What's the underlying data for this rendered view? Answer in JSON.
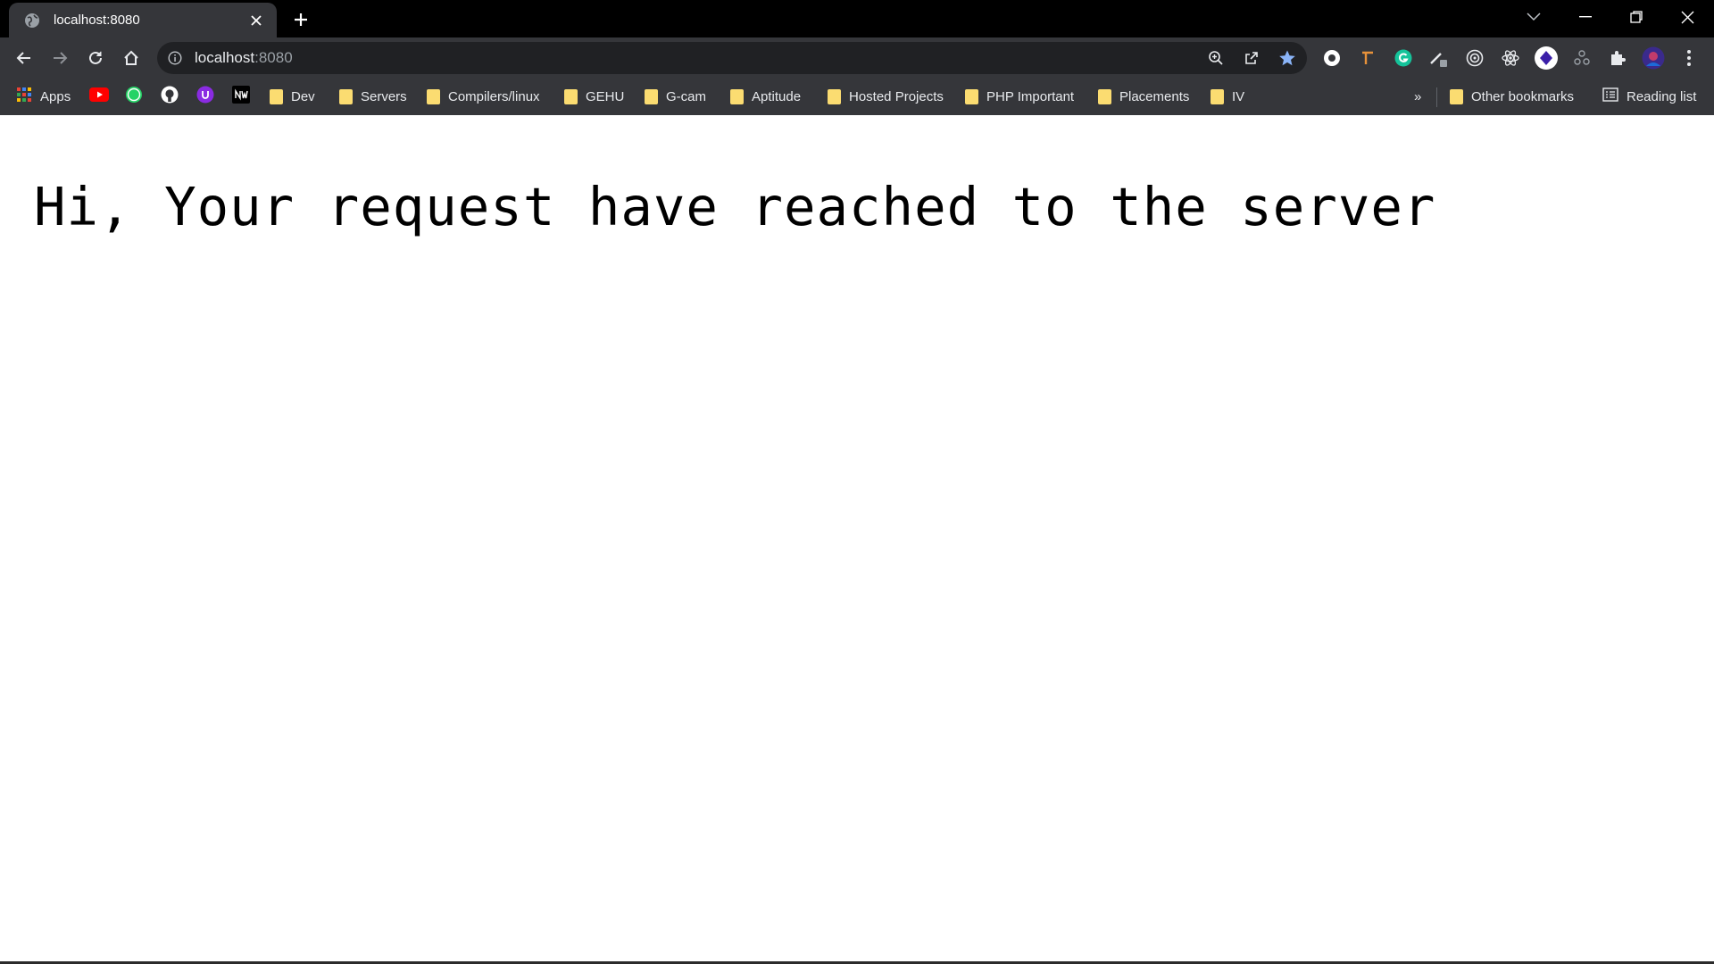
{
  "browser": {
    "tab": {
      "title": "localhost:8080"
    },
    "omnibox": {
      "host": "localhost",
      "port": ":8080"
    }
  },
  "bookmarks": {
    "apps_label": "Apps",
    "folders": [
      "Dev",
      "Servers",
      "Compilers/linux",
      "GEHU",
      "G-cam",
      "Aptitude",
      "Hosted Projects",
      "PHP Important",
      "Placements",
      "IV"
    ],
    "overflow_label": "»",
    "other_label": "Other bookmarks",
    "reading_list_label": "Reading list"
  },
  "page": {
    "message": "Hi, Your request have reached to the server"
  },
  "colors": {
    "tabstrip": "#000000",
    "toolbar": "#35363a",
    "omnibox": "#202124",
    "folder": "#fbdc71",
    "star": "#8ab4f8",
    "page_bg": "#ffffff",
    "page_text": "#000000"
  }
}
